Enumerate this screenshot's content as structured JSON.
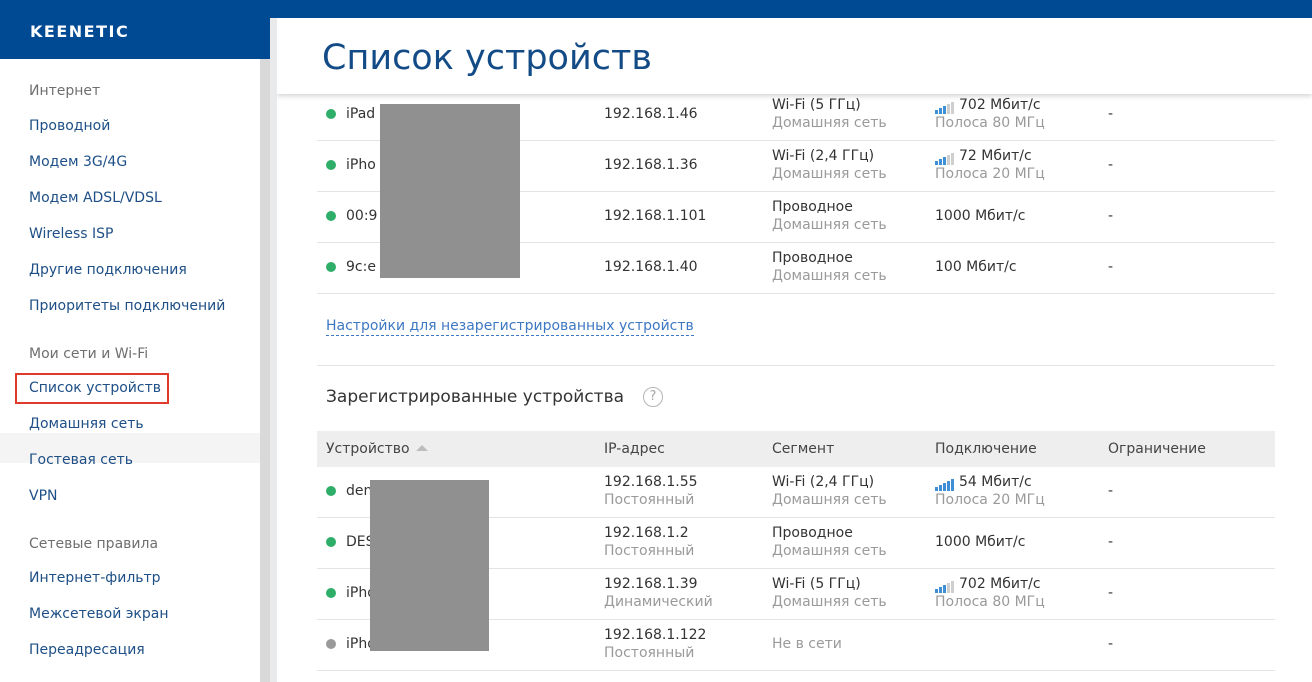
{
  "brand": {
    "logo": "KEENETIC"
  },
  "sidebar": {
    "groups": [
      {
        "header": "Интернет",
        "items": [
          "Проводной",
          "Модем 3G/4G",
          "Модем ADSL/VDSL",
          "Wireless ISP",
          "Другие подключения",
          "Приоритеты подключений"
        ]
      },
      {
        "header": "Мои сети и Wi-Fi",
        "items": [
          "Список устройств",
          "Домашняя сеть",
          "Гостевая сеть",
          "VPN"
        ]
      },
      {
        "header": "Сетевые правила",
        "items": [
          "Интернет-фильтр",
          "Межсетевой экран",
          "Переадресация"
        ]
      }
    ],
    "active_item": "Список устройств"
  },
  "page": {
    "title": "Список устройств"
  },
  "unregistered": {
    "rows": [
      {
        "name": "iPad",
        "ip": "192.168.1.46",
        "segment": "Wi-Fi (5 ГГц)",
        "segment_sub": "Домашняя сеть",
        "connection": "702 Мбит/с",
        "connection_sub": "Полоса 80 МГц",
        "limit": "-",
        "status": "online",
        "signal_bars": 3
      },
      {
        "name": "iPho",
        "ip": "192.168.1.36",
        "segment": "Wi-Fi (2,4 ГГц)",
        "segment_sub": "Домашняя сеть",
        "connection": "72 Мбит/с",
        "connection_sub": "Полоса 20 МГц",
        "limit": "-",
        "status": "online",
        "signal_bars": 3
      },
      {
        "name": "00:9",
        "ip": "192.168.1.101",
        "segment": "Проводное",
        "segment_sub": "Домашняя сеть",
        "connection": "1000 Мбит/с",
        "connection_sub": "",
        "limit": "-",
        "status": "online",
        "signal_bars": 0
      },
      {
        "name": "9c:e",
        "ip": "192.168.1.40",
        "segment": "Проводное",
        "segment_sub": "Домашняя сеть",
        "connection": "100 Мбит/с",
        "connection_sub": "",
        "limit": "-",
        "status": "online",
        "signal_bars": 0
      }
    ],
    "settings_link": "Настройки для незарегистрированных устройств"
  },
  "registered": {
    "title": "Зарегистрированные устройства",
    "help_icon": "?",
    "columns": [
      "Устройство",
      "IP-адрес",
      "Сегмент",
      "Подключение",
      "Ограничение"
    ],
    "rows": [
      {
        "name": "den",
        "ip": "192.168.1.55",
        "ip_sub": "Постоянный",
        "segment": "Wi-Fi (2,4 ГГц)",
        "segment_sub": "Домашняя сеть",
        "connection": "54 Мбит/с",
        "connection_sub": "Полоса 20 МГц",
        "limit": "-",
        "status": "online",
        "signal_bars": 5
      },
      {
        "name": "DES",
        "ip": "192.168.1.2",
        "ip_sub": "Постоянный",
        "segment": "Проводное",
        "segment_sub": "Домашняя сеть",
        "connection": "1000 Мбит/с",
        "connection_sub": "",
        "limit": "-",
        "status": "online",
        "signal_bars": 0
      },
      {
        "name": "iPho",
        "ip": "192.168.1.39",
        "ip_sub": "Динамический",
        "segment": "Wi-Fi (5 ГГц)",
        "segment_sub": "Домашняя сеть",
        "connection": "702 Мбит/с",
        "connection_sub": "Полоса 80 МГц",
        "limit": "-",
        "status": "online",
        "signal_bars": 3
      },
      {
        "name": "iPho",
        "ip": "192.168.1.122",
        "ip_sub": "Постоянный",
        "segment": "Не в сети",
        "segment_sub": "",
        "connection": "",
        "connection_sub": "",
        "limit": "-",
        "status": "offline",
        "signal_bars": 0
      }
    ]
  },
  "colors": {
    "brand_blue": "#004a94",
    "link_blue": "#1e4f86",
    "status_online": "#2fae6a",
    "status_offline": "#9a9a9a",
    "signal_active": "#3f8fd6",
    "signal_inactive": "#cfcfcf",
    "highlight_red": "#e03a2a"
  }
}
